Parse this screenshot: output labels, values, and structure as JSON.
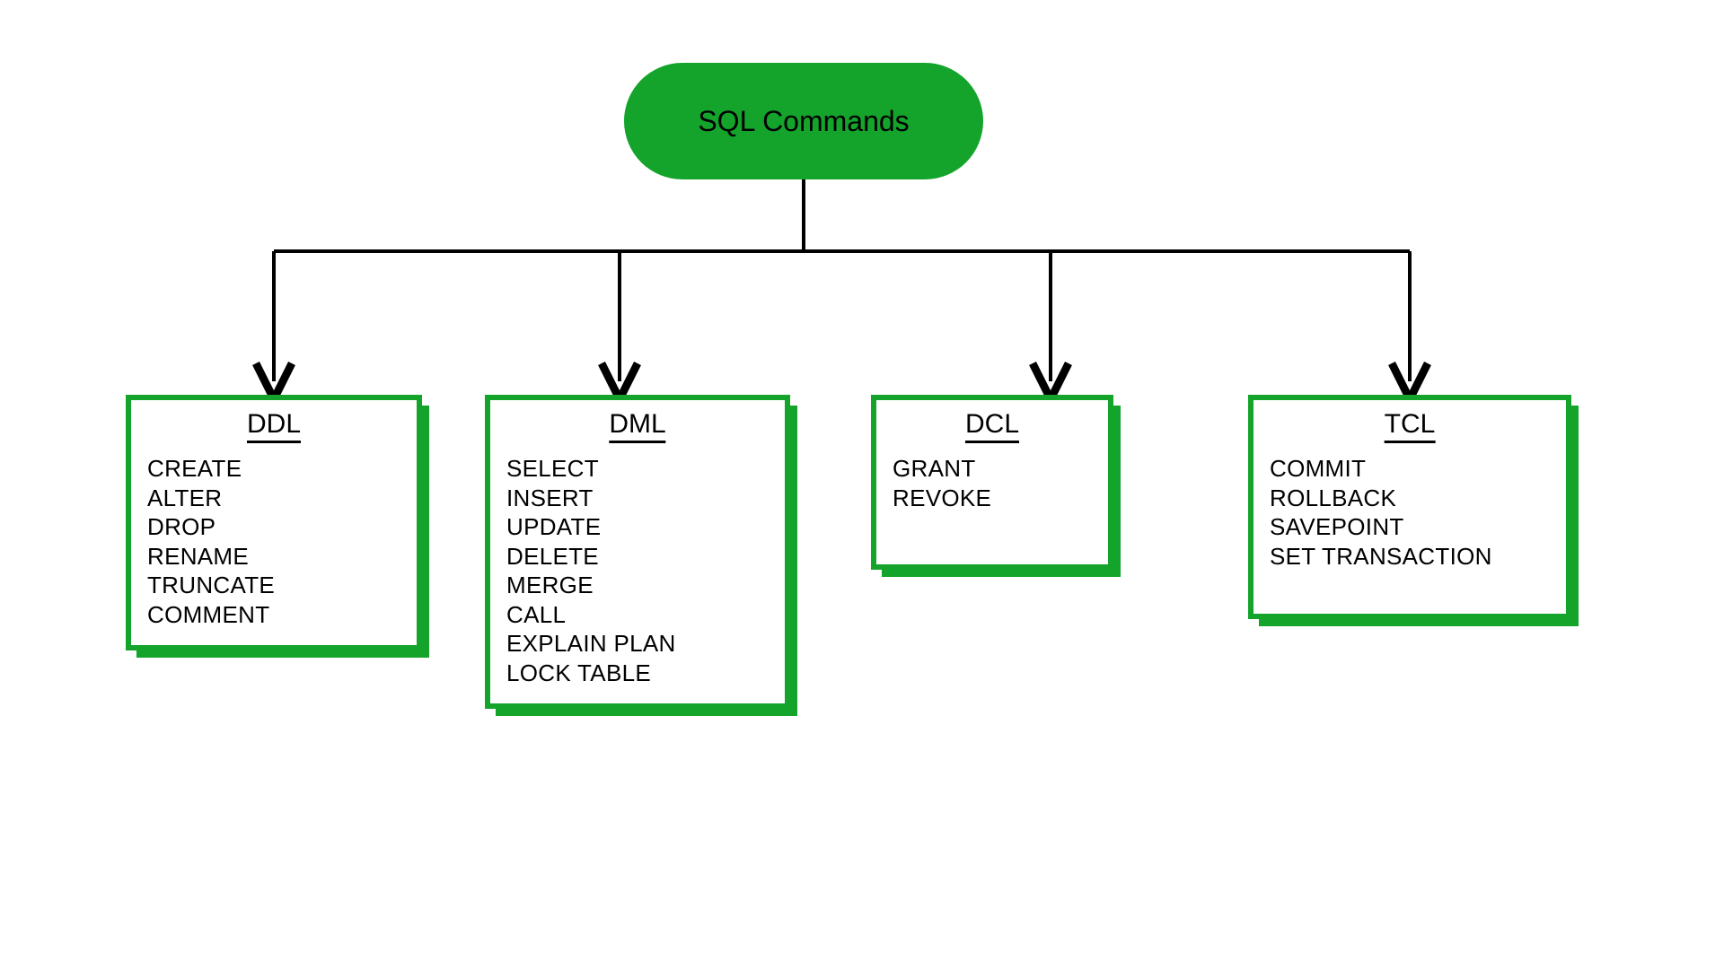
{
  "root": {
    "title": "SQL Commands"
  },
  "categories": [
    {
      "key": "ddl",
      "title": "DDL",
      "commands": [
        "CREATE",
        "ALTER",
        "DROP",
        "RENAME",
        "TRUNCATE",
        "COMMENT"
      ]
    },
    {
      "key": "dml",
      "title": "DML",
      "commands": [
        "SELECT",
        "INSERT",
        "UPDATE",
        "DELETE",
        "MERGE",
        "CALL",
        "EXPLAIN PLAN",
        "LOCK TABLE"
      ]
    },
    {
      "key": "dcl",
      "title": "DCL",
      "commands": [
        "GRANT",
        "REVOKE"
      ]
    },
    {
      "key": "tcl",
      "title": "TCL",
      "commands": [
        "COMMIT",
        "ROLLBACK",
        "SAVEPOINT",
        "SET TRANSACTION"
      ]
    }
  ],
  "colors": {
    "accent": "#14a42b",
    "line": "#000000"
  },
  "chart_data": {
    "type": "tree",
    "root": "SQL Commands",
    "children": [
      {
        "name": "DDL",
        "items": [
          "CREATE",
          "ALTER",
          "DROP",
          "RENAME",
          "TRUNCATE",
          "COMMENT"
        ]
      },
      {
        "name": "DML",
        "items": [
          "SELECT",
          "INSERT",
          "UPDATE",
          "DELETE",
          "MERGE",
          "CALL",
          "EXPLAIN PLAN",
          "LOCK TABLE"
        ]
      },
      {
        "name": "DCL",
        "items": [
          "GRANT",
          "REVOKE"
        ]
      },
      {
        "name": "TCL",
        "items": [
          "COMMIT",
          "ROLLBACK",
          "SAVEPOINT",
          "SET TRANSACTION"
        ]
      }
    ]
  }
}
